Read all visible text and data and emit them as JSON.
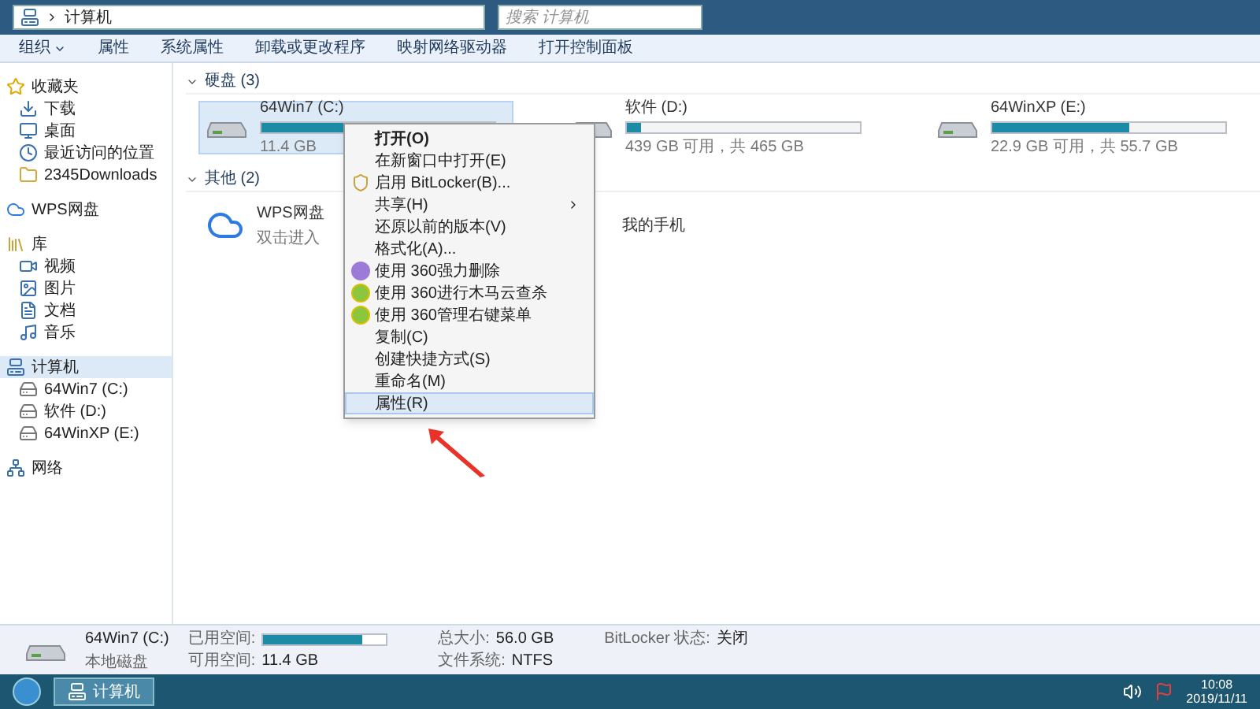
{
  "address": {
    "path": "计算机",
    "placeholder": "搜索 计算机"
  },
  "toolbar": [
    {
      "label": "组织",
      "has_menu": true
    },
    {
      "label": "属性",
      "has_menu": false
    },
    {
      "label": "系统属性",
      "has_menu": false
    },
    {
      "label": "卸载或更改程序",
      "has_menu": false
    },
    {
      "label": "映射网络驱动器",
      "has_menu": false
    },
    {
      "label": "打开控制面板",
      "has_menu": false
    }
  ],
  "sidebar": [
    {
      "label": "收藏夹",
      "selected": false,
      "children": [
        {
          "label": "下载",
          "selected": false
        },
        {
          "label": "桌面",
          "selected": false
        },
        {
          "label": "最近访问的位置",
          "selected": false
        },
        {
          "label": "2345Downloads",
          "selected": false
        }
      ]
    },
    {
      "label": "WPS网盘",
      "selected": false
    },
    {
      "label": "库",
      "selected": false,
      "children": [
        {
          "label": "视频",
          "selected": false
        },
        {
          "label": "图片",
          "selected": false
        },
        {
          "label": "文档",
          "selected": false
        },
        {
          "label": "音乐",
          "selected": false
        }
      ]
    },
    {
      "label": "计算机",
      "selected": true,
      "children": [
        {
          "label": "64Win7 (C:)",
          "selected": false
        },
        {
          "label": "软件 (D:)",
          "selected": false
        },
        {
          "label": "64WinXP (E:)",
          "selected": false
        }
      ]
    },
    {
      "label": "网络",
      "selected": false
    }
  ],
  "sections": [
    {
      "title": "硬盘 (3)",
      "items": [
        {
          "kind": "drive",
          "name": "64Win7 (C:)",
          "level": 0.8,
          "info": "11.4 GB",
          "selected": true
        },
        {
          "kind": "drive",
          "name": "软件 (D:)",
          "level": 0.06,
          "info": "439 GB 可用，共 465 GB",
          "selected": false
        },
        {
          "kind": "drive",
          "name": "64WinXP (E:)",
          "level": 0.59,
          "info": "22.9 GB 可用，共 55.7 GB",
          "selected": false
        }
      ]
    },
    {
      "title": "其他 (2)",
      "items": [
        {
          "kind": "cloud",
          "name": "WPS网盘",
          "info": "双击进入"
        },
        {
          "kind": "phone",
          "name": "我的手机"
        }
      ]
    }
  ],
  "context_menu": [
    {
      "label": "打开(O)",
      "bold": true,
      "kind": "plain",
      "submenu": false,
      "selected": false
    },
    {
      "label": "在新窗口中打开(E)",
      "bold": false,
      "kind": "plain",
      "submenu": false,
      "selected": false
    },
    {
      "label": "启用 BitLocker(B)...",
      "bold": false,
      "kind": "shield",
      "submenu": false,
      "selected": false
    },
    {
      "label": "共享(H)",
      "bold": false,
      "kind": "plain",
      "submenu": true,
      "selected": false
    },
    {
      "label": "还原以前的版本(V)",
      "bold": false,
      "kind": "plain",
      "submenu": false,
      "selected": false
    },
    {
      "label": "格式化(A)...",
      "bold": false,
      "kind": "plain",
      "submenu": false,
      "selected": false
    },
    {
      "label": "使用 360强力删除",
      "bold": false,
      "kind": "purple",
      "submenu": false,
      "selected": false
    },
    {
      "label": "使用 360进行木马云查杀",
      "bold": false,
      "kind": "green",
      "submenu": false,
      "selected": false
    },
    {
      "label": "使用 360管理右键菜单",
      "bold": false,
      "kind": "green",
      "submenu": false,
      "selected": false
    },
    {
      "label": "复制(C)",
      "bold": false,
      "kind": "plain",
      "submenu": false,
      "selected": false
    },
    {
      "label": "创建快捷方式(S)",
      "bold": false,
      "kind": "plain",
      "submenu": false,
      "selected": false
    },
    {
      "label": "重命名(M)",
      "bold": false,
      "kind": "plain",
      "submenu": false,
      "selected": false
    },
    {
      "label": "属性(R)",
      "bold": false,
      "kind": "plain",
      "submenu": false,
      "selected": true
    }
  ],
  "details": {
    "name": "64Win7 (C:)",
    "type": "本地磁盘",
    "fields": [
      {
        "kind": "bar",
        "label": "已用空间:",
        "level": 0.8
      },
      {
        "kind": "text",
        "label": "可用空间:",
        "value": "11.4 GB"
      },
      {
        "kind": "text",
        "label": "总大小:",
        "value": "56.0 GB"
      },
      {
        "kind": "text",
        "label": "文件系统:",
        "value": "NTFS"
      },
      {
        "kind": "text",
        "label": "BitLocker 状态:",
        "value": "关闭"
      }
    ]
  },
  "taskbar": {
    "items": [
      {
        "label": "计算机",
        "selected": true
      }
    ],
    "time": "10:08",
    "date": "2019/11/11"
  }
}
